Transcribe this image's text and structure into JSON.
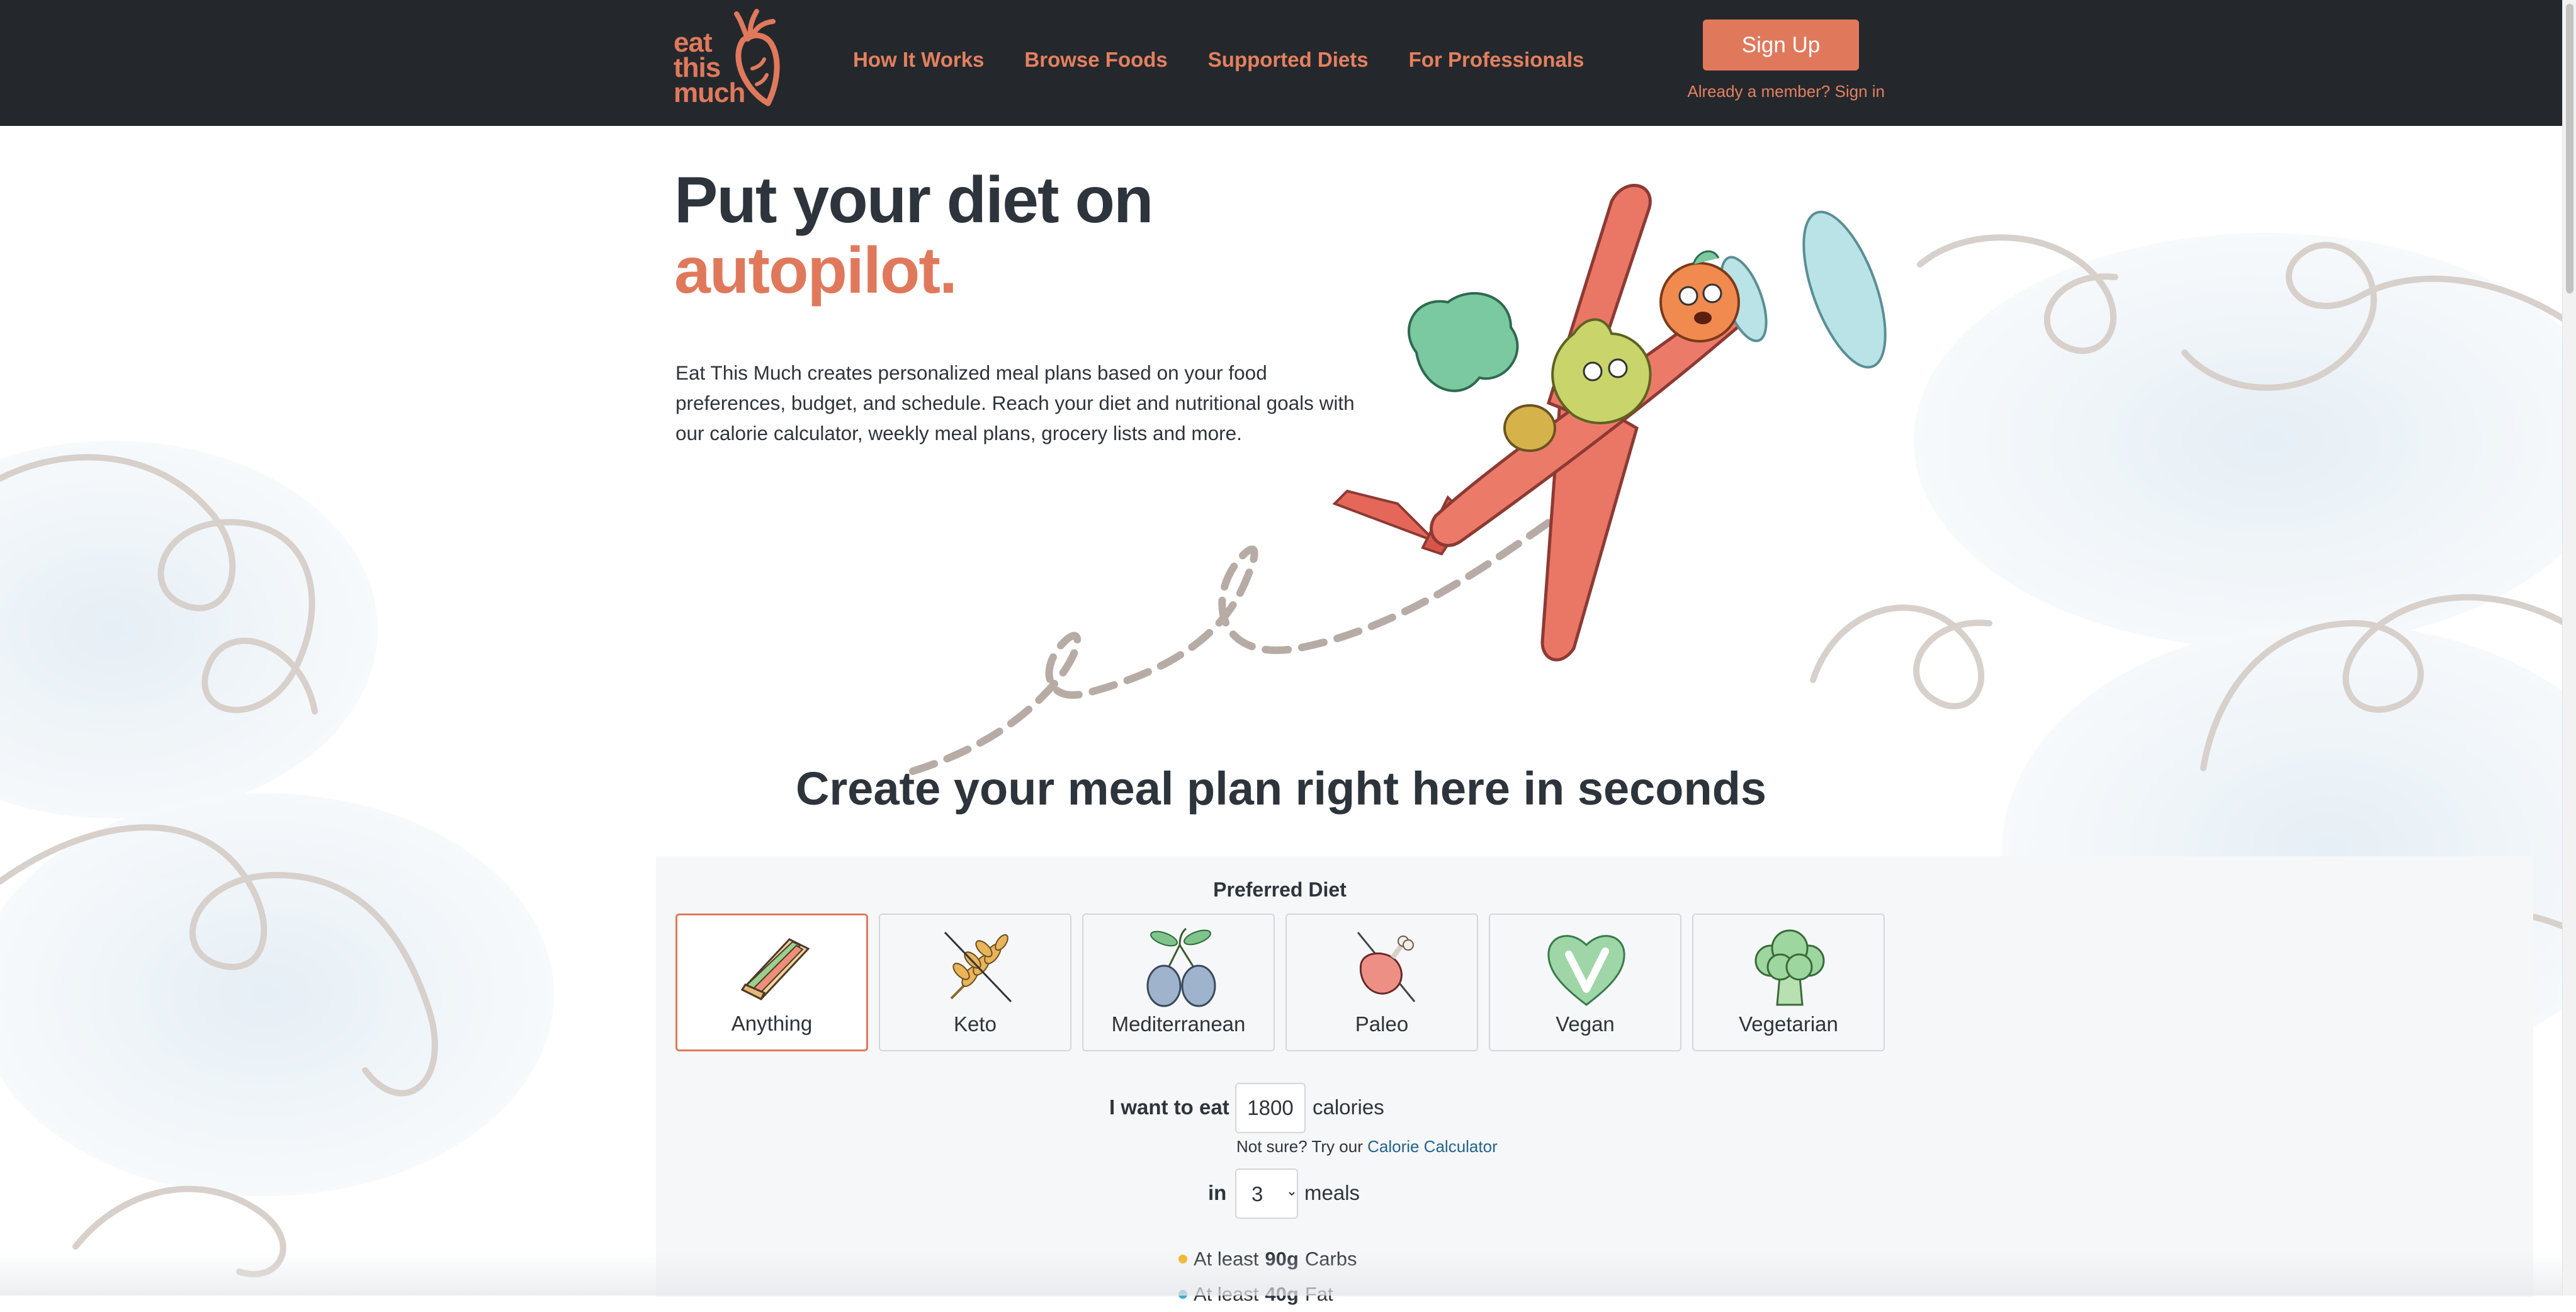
{
  "brand": {
    "logo_lines": [
      "eat",
      "this",
      "much"
    ],
    "accent_color": "#e0795c",
    "header_bg": "#24282c"
  },
  "nav": {
    "items": [
      {
        "label": "How It Works"
      },
      {
        "label": "Browse Foods"
      },
      {
        "label": "Supported Diets"
      },
      {
        "label": "For Professionals"
      }
    ]
  },
  "header": {
    "signup_label": "Sign Up",
    "signin_label": "Already a member? Sign in"
  },
  "hero": {
    "title_line1": "Put your diet on",
    "title_line2": "autopilot.",
    "description": "Eat This Much creates personalized meal plans based on your food preferences, budget, and schedule. Reach your diet and nutritional goals with our calorie calculator, weekly meal plans, grocery lists and more."
  },
  "meal_plan": {
    "section_title": "Create your meal plan right here in seconds",
    "preferred_diet_label": "Preferred Diet",
    "diets": [
      {
        "label": "Anything",
        "icon": "sandwich-icon",
        "selected": true
      },
      {
        "label": "Keto",
        "icon": "wheat-crossed-icon",
        "selected": false
      },
      {
        "label": "Mediterranean",
        "icon": "olives-icon",
        "selected": false
      },
      {
        "label": "Paleo",
        "icon": "drumstick-icon",
        "selected": false
      },
      {
        "label": "Vegan",
        "icon": "vegan-heart-icon",
        "selected": false
      },
      {
        "label": "Vegetarian",
        "icon": "broccoli-icon",
        "selected": false
      }
    ],
    "calories_prefix": "I want to eat",
    "calories_value": "1800",
    "calories_unit": "calories",
    "not_sure_text": "Not sure? Try our",
    "calculator_link": "Calorie Calculator",
    "meals_prefix": "in",
    "meals_value": "3",
    "meals_unit": "meals",
    "macros": [
      {
        "prefix": "At least",
        "amount": "90g",
        "name": "Carbs",
        "color": "#f0b429"
      },
      {
        "prefix": "At least",
        "amount": "40g",
        "name": "Fat",
        "color": "#3fa9c9"
      }
    ]
  }
}
